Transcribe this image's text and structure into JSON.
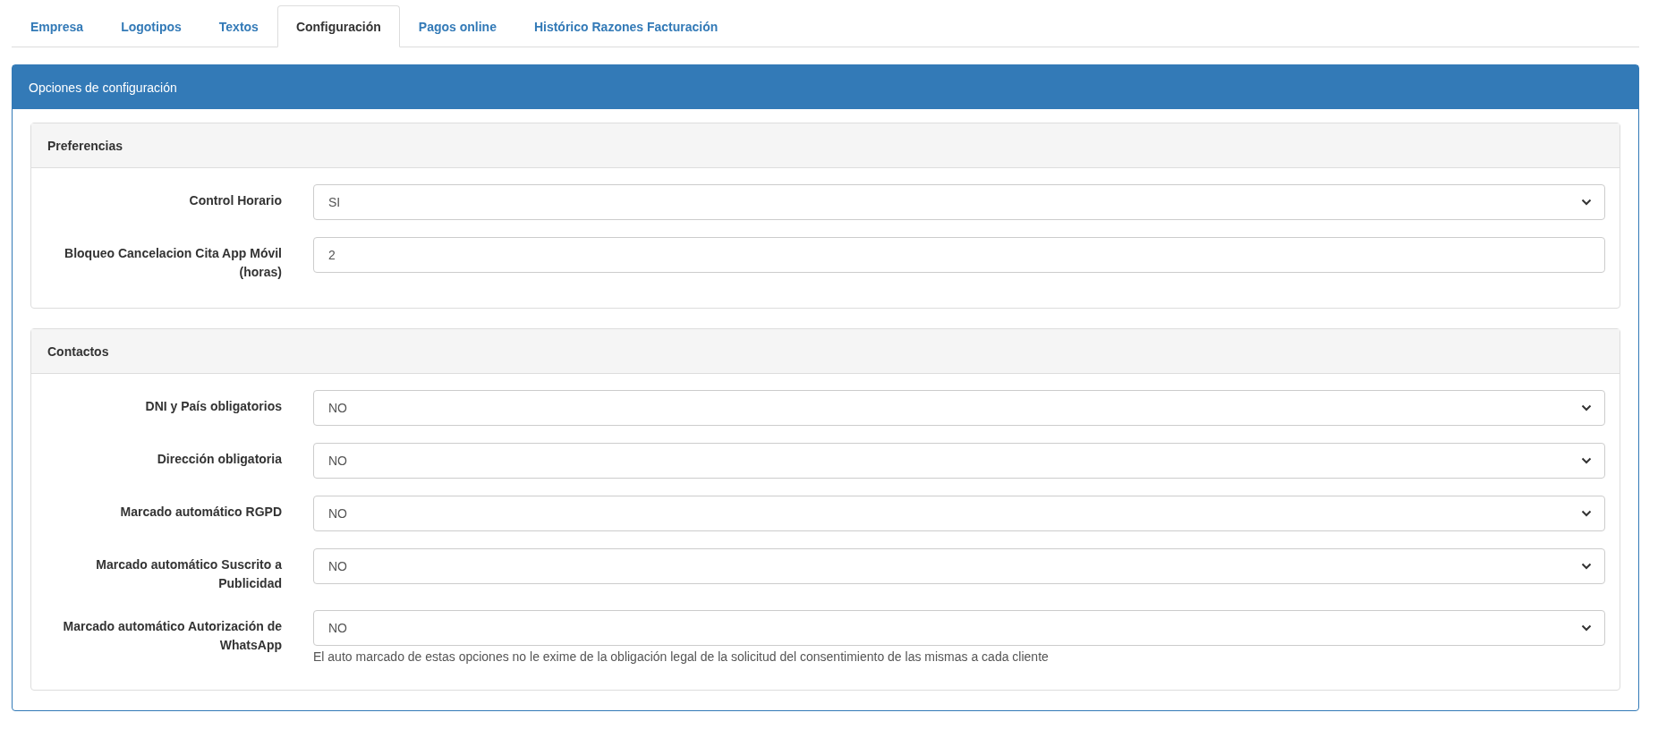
{
  "tabs": [
    {
      "label": "Empresa",
      "selected": false
    },
    {
      "label": "Logotipos",
      "selected": false
    },
    {
      "label": "Textos",
      "selected": false
    },
    {
      "label": "Configuración",
      "selected": true
    },
    {
      "label": "Pagos online",
      "selected": false
    },
    {
      "label": "Histórico Razones Facturación",
      "selected": false
    }
  ],
  "panel": {
    "title": "Opciones de configuración",
    "sections": [
      {
        "title": "Preferencias",
        "fields": [
          {
            "kind": "select",
            "label": "Control Horario",
            "value": "SI"
          },
          {
            "kind": "input",
            "label": "Bloqueo Cancelacion Cita App Móvil (horas)",
            "value": "2"
          }
        ]
      },
      {
        "title": "Contactos",
        "fields": [
          {
            "kind": "select",
            "label": "DNI y País obligatorios",
            "value": "NO"
          },
          {
            "kind": "select",
            "label": "Dirección obligatoria",
            "value": "NO"
          },
          {
            "kind": "select",
            "label": "Marcado automático RGPD",
            "value": "NO"
          },
          {
            "kind": "select",
            "label": "Marcado automático Suscrito a Publicidad",
            "value": "NO"
          },
          {
            "kind": "select",
            "label": "Marcado automático Autorización de WhatsApp",
            "value": "NO",
            "help": "El auto marcado de estas opciones no le exime de la obligación legal de la solicitud del consentimiento de las mismas a cada cliente"
          }
        ]
      }
    ]
  }
}
